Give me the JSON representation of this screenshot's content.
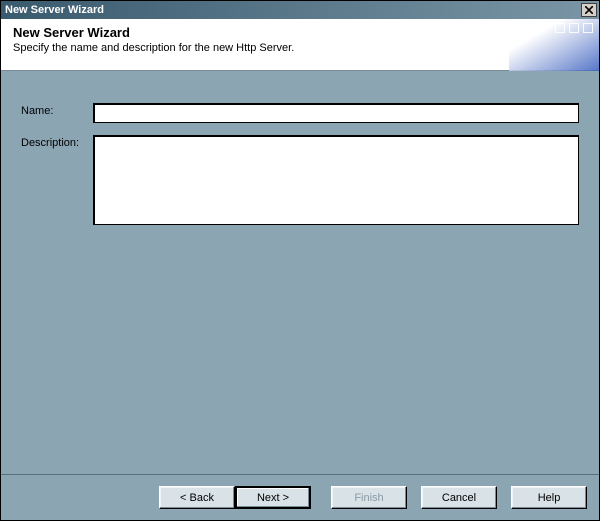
{
  "window": {
    "title": "New Server Wizard"
  },
  "header": {
    "title": "New Server Wizard",
    "subtitle": "Specify the name and description for the new Http Server."
  },
  "form": {
    "name_label": "Name:",
    "name_value": "",
    "description_label": "Description:",
    "description_value": ""
  },
  "buttons": {
    "back": "< Back",
    "next": "Next >",
    "finish": "Finish",
    "cancel": "Cancel",
    "help": "Help"
  }
}
